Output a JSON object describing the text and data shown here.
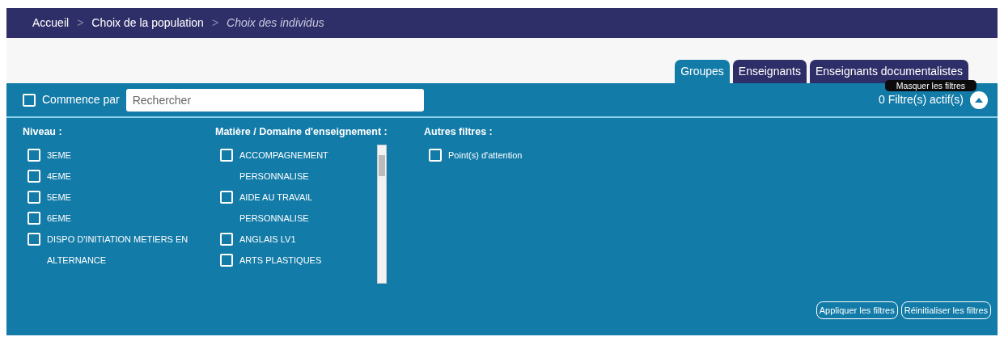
{
  "breadcrumb": [
    {
      "label": "Accueil",
      "current": false
    },
    {
      "label": "Choix de la population",
      "current": false
    },
    {
      "label": "Choix des individus",
      "current": true
    }
  ],
  "breadcrumb_separator": ">",
  "tabs": [
    {
      "label": "Groupes",
      "selected": true
    },
    {
      "label": "Enseignants",
      "selected": false
    },
    {
      "label": "Enseignants documentalistes",
      "selected": false
    }
  ],
  "search": {
    "starts_with": {
      "label": "Commence par",
      "checked": false
    },
    "placeholder": "Rechercher"
  },
  "active_filters": "0 Filtre(s) actif(s)",
  "tooltip": "Masquer les filtres",
  "filter_groups": [
    {
      "title": "Niveau :",
      "scrollable": false,
      "options": [
        {
          "label": "3EME",
          "checked": false
        },
        {
          "label": "4EME",
          "checked": false
        },
        {
          "label": "5EME",
          "checked": false
        },
        {
          "label": "6EME",
          "checked": false
        },
        {
          "label": "DISPO D'INITIATION METIERS EN ALTERNANCE",
          "checked": false
        }
      ]
    },
    {
      "title": "Matière / Domaine d'enseignement :",
      "scrollable": true,
      "options": [
        {
          "label": "ACCOMPAGNEMENT PERSONNALISE",
          "checked": false
        },
        {
          "label": "AIDE AU TRAVAIL PERSONNALISE",
          "checked": false
        },
        {
          "label": "ANGLAIS LV1",
          "checked": false
        },
        {
          "label": "ARTS PLASTIQUES",
          "checked": false
        }
      ]
    },
    {
      "title": "Autres filtres :",
      "scrollable": false,
      "options": [
        {
          "label": "Point(s) d'attention",
          "checked": false
        }
      ]
    }
  ],
  "buttons": [
    "Appliquer les filtres",
    "Réinitialiser les filtres"
  ]
}
